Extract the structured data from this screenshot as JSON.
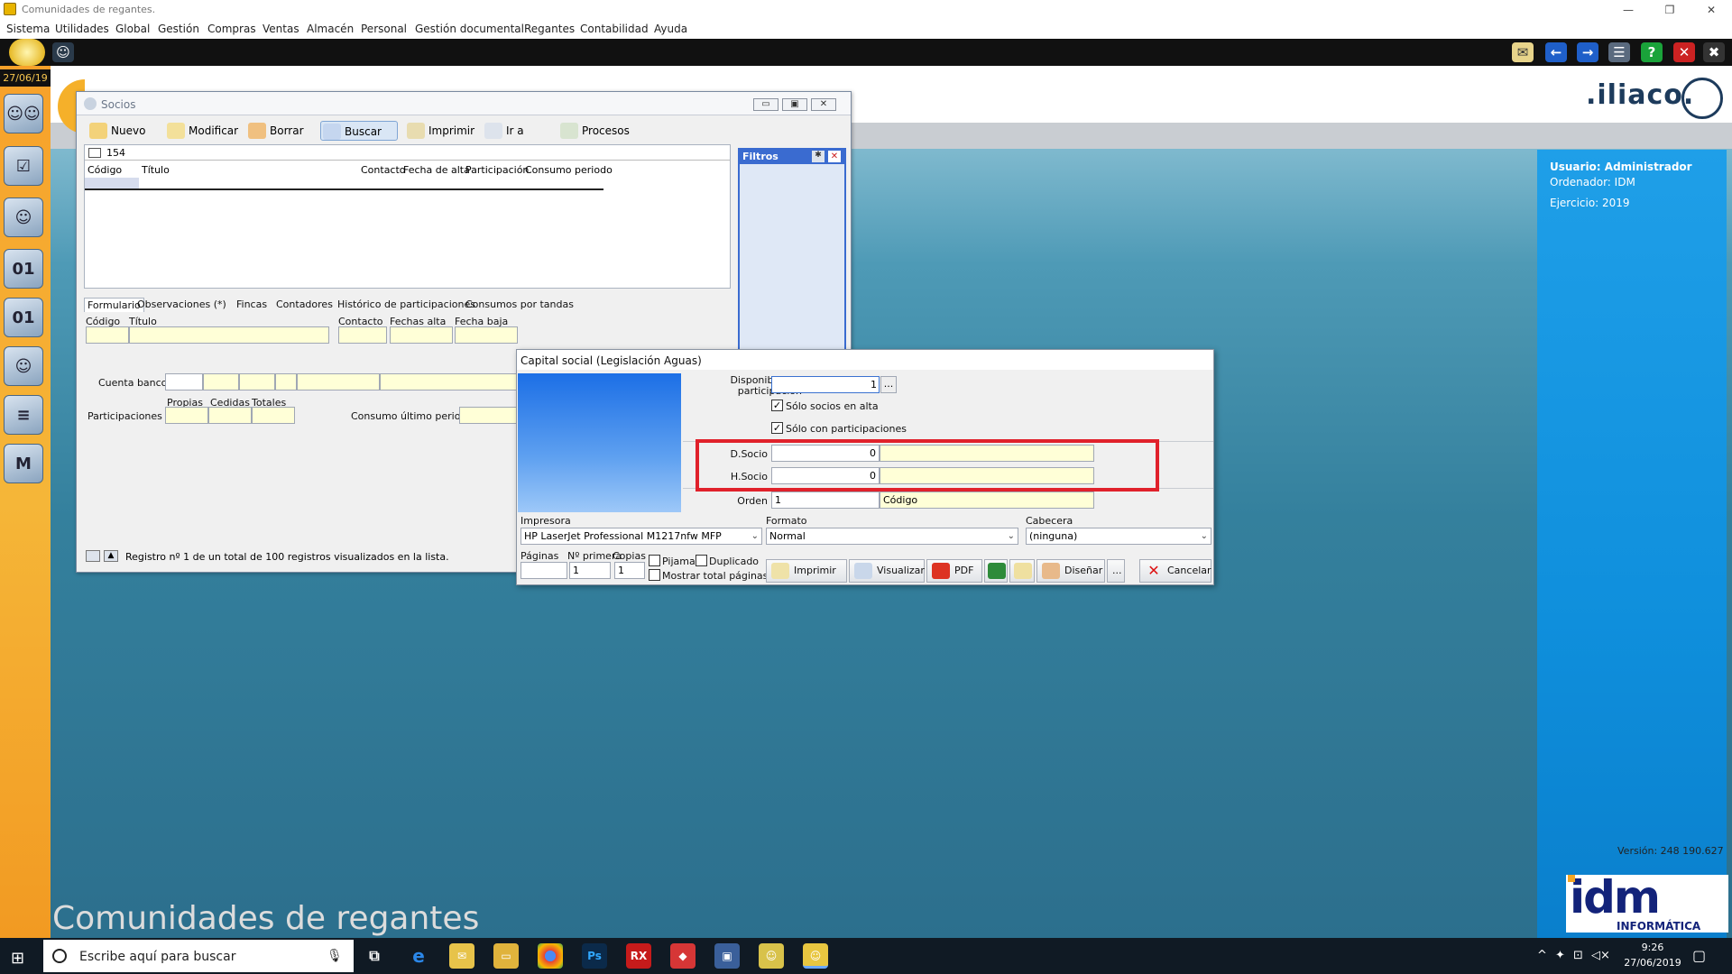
{
  "window": {
    "title": "Comunidades de regantes."
  },
  "menu": [
    "Sistema",
    "Utilidades",
    "Global",
    "Gestión",
    "Compras",
    "Ventas",
    "Almacén",
    "Personal",
    "Gestión documental",
    "Regantes",
    "Contabilidad",
    "Ayuda"
  ],
  "sidebar": {
    "date": "27/06/19"
  },
  "brand": {
    "iliaco": ".iliaco.",
    "big_title": "Comunidades de regantes",
    "idm": "idm",
    "idm_sub": "INFORMÁTICA"
  },
  "user_panel": {
    "usuario": "Usuario: Administrador",
    "ordenador": "Ordenador: IDM",
    "ejercicio": "Ejercicio: 2019"
  },
  "version": "Versión: 248 190.627",
  "socios": {
    "title": "Socios",
    "toolbar": {
      "nuevo": "Nuevo",
      "modificar": "Modificar",
      "borrar": "Borrar",
      "buscar": "Buscar",
      "imprimir": "Imprimir",
      "ir_a": "Ir a",
      "procesos": "Procesos"
    },
    "count": "154",
    "columns": [
      "Código",
      "Título",
      "Contacto",
      "Fecha de alta",
      "Participación",
      "Consumo periodo"
    ],
    "filtros": "Filtros",
    "tabs": [
      "Formulario",
      "Observaciones (*)",
      "Fincas",
      "Contadores",
      "Histórico de participaciones",
      "Consumos por tandas"
    ],
    "form": {
      "codigo": "Código",
      "titulo": "Título",
      "contacto": "Contacto",
      "fechas_alta": "Fechas alta",
      "fecha_baja": "Fecha baja",
      "cuenta_banco": "Cuenta banco",
      "participaciones": "Participaciones",
      "propias": "Propias",
      "cedidas": "Cedidas",
      "totales": "Totales",
      "consumo_ultimo": "Consumo último periodo"
    },
    "status": "Registro nº 1 de un total de 100 registros visualizados en la lista."
  },
  "dialog": {
    "title": "Capital social (Legislación Aguas)",
    "disponible_label_1": "Disponible por",
    "disponible_label_2": "participación",
    "disponible_value": "1",
    "solo_alta": "Sólo socios en alta",
    "solo_participaciones": "Sólo con participaciones",
    "dsocio_label": "D.Socio",
    "dsocio_value": "0",
    "hsocio_label": "H.Socio",
    "hsocio_value": "0",
    "orden_label": "Orden",
    "orden_value": "1",
    "orden_desc": "Código",
    "impresora_label": "Impresora",
    "impresora_value": "HP LaserJet Professional M1217nfw MFP",
    "formato_label": "Formato",
    "formato_value": "Normal",
    "cabecera_label": "Cabecera",
    "cabecera_value": "(ninguna)",
    "paginas_label": "Páginas",
    "primera_label": "Nº primera",
    "copias_label": "Copias",
    "primera_value": "1",
    "copias_value": "1",
    "pijama": "Pijama",
    "duplicado": "Duplicado",
    "mostrar_total": "Mostrar total páginas",
    "buttons": {
      "imprimir": "Imprimir",
      "visualizar": "Visualizar",
      "pdf": "PDF",
      "disenar": "Diseñar",
      "more": "...",
      "cancelar": "Cancelar"
    }
  },
  "taskbar": {
    "search_placeholder": "Escribe aquí para buscar",
    "time": "9:26",
    "date": "27/06/2019"
  }
}
